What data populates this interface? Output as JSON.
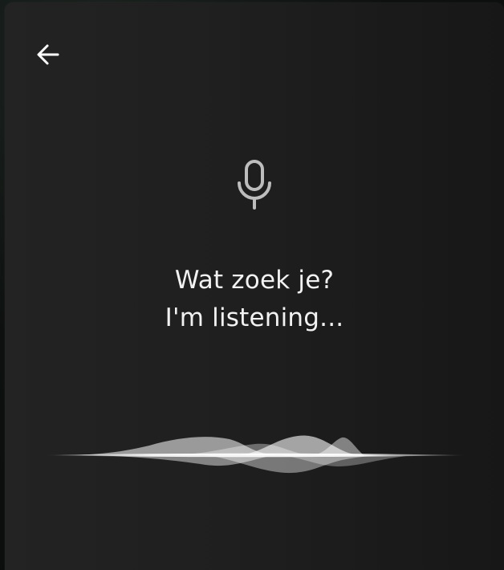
{
  "voice_search": {
    "back_icon": "arrow-left-icon",
    "mic_icon": "microphone-icon",
    "prompt_title": "Wat zoek je?",
    "prompt_status": "I'm listening...",
    "colors": {
      "panel_background": "#1f1f1f",
      "text": "#f2f2f2",
      "icon": "#bdbdbd",
      "wave": "#ffffff"
    }
  }
}
